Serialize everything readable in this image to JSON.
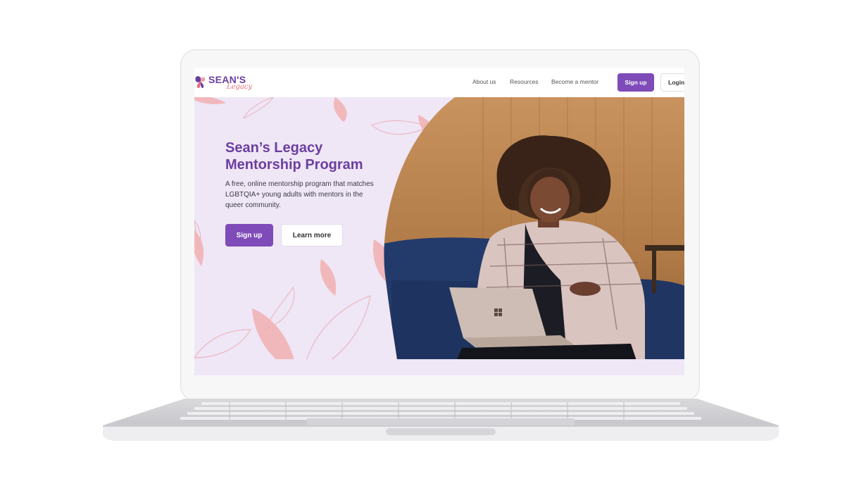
{
  "logo": {
    "wordmark": "SEAN'S",
    "script": "Legacy"
  },
  "nav": {
    "links": [
      "About us",
      "Resources",
      "Become a mentor"
    ],
    "signup_label": "Sign up",
    "login_label": "Login"
  },
  "hero": {
    "title_line1": "Sean’s Legacy",
    "title_line2": "Mentorship Program",
    "subtitle_line1": "A free, online mentorship program that matches",
    "subtitle_line2": "LGBTQIA+ young adults with mentors in the",
    "subtitle_line3": "queer community.",
    "signup_label": "Sign up",
    "learn_more_label": "Learn more",
    "photo_icon": "woman-with-laptop-photo"
  },
  "colors": {
    "brand_purple": "#7e4bb8",
    "hero_background": "#efe6f6",
    "leaf_pink": "#f1b8bc"
  }
}
